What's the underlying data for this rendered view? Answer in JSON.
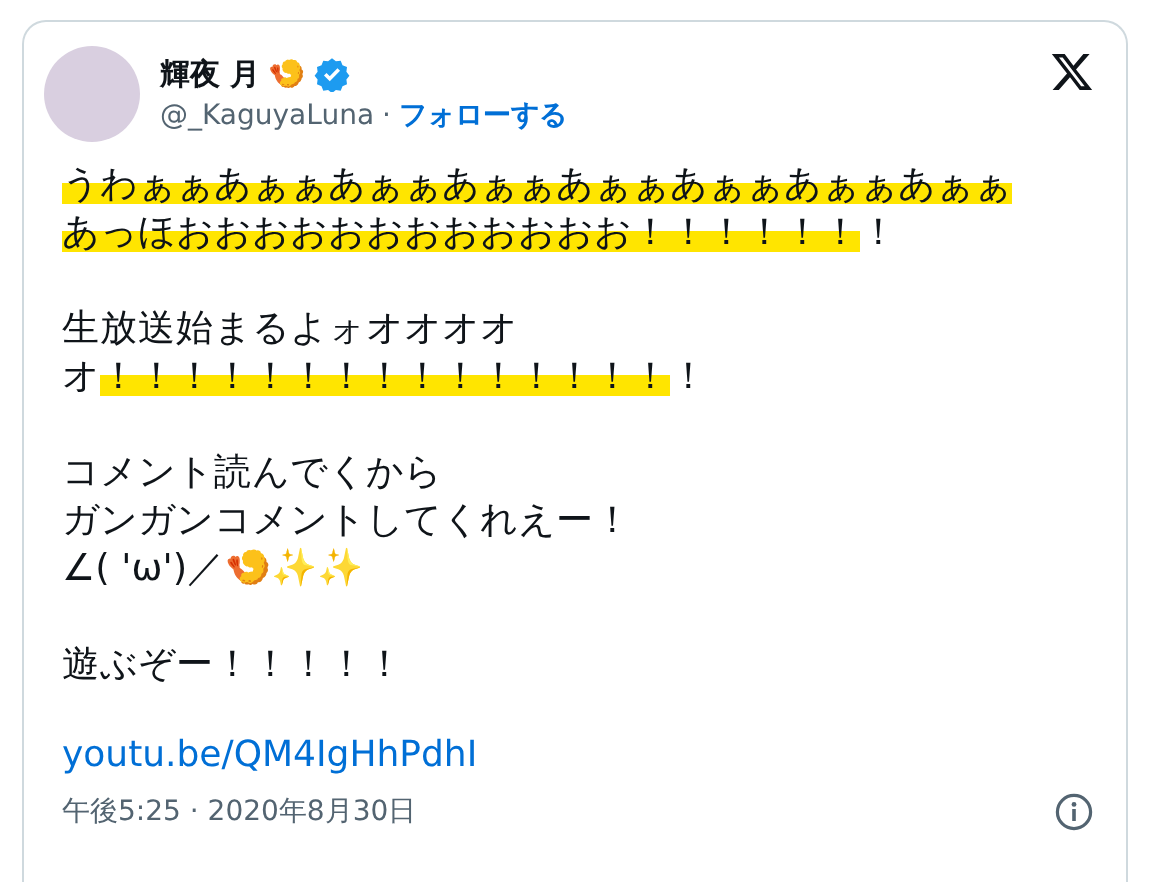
{
  "author": {
    "name": "輝夜 月",
    "name_emoji": "🍤",
    "verified": true,
    "handle": "@_KaguyaLuna",
    "separator": "·",
    "follow": "フォローする"
  },
  "paragraphs": [
    [
      [
        {
          "text": "うわぁぁあぁぁあぁぁあぁぁあぁぁあぁぁあぁぁあぁぁ",
          "highlighted": true
        }
      ],
      [
        {
          "text": "あっほおおおおおおおおおおおお！！！！！！",
          "highlighted": true
        },
        {
          "text": "！",
          "highlighted": false
        }
      ]
    ],
    [
      [
        {
          "text": "生放送始まるよォオオオオ",
          "highlighted": false
        }
      ],
      [
        {
          "text": "オ",
          "highlighted": false
        },
        {
          "text": "！！！！！！！！！！！！！！！",
          "highlighted": true
        },
        {
          "text": "！",
          "highlighted": false
        }
      ]
    ],
    [
      [
        {
          "text": "コメント読んでくから",
          "highlighted": false
        }
      ],
      [
        {
          "text": "ガンガンコメントしてくれえー！",
          "highlighted": false
        }
      ],
      [
        {
          "text": "∠( 'ω')／🍤✨✨",
          "highlighted": false
        }
      ]
    ],
    [
      [
        {
          "text": "遊ぶぞー！！！！！",
          "highlighted": false
        }
      ]
    ]
  ],
  "link": "youtu.be/QM4IgHhPdhI",
  "timestamp": "午後5:25 · 2020年8月30日"
}
